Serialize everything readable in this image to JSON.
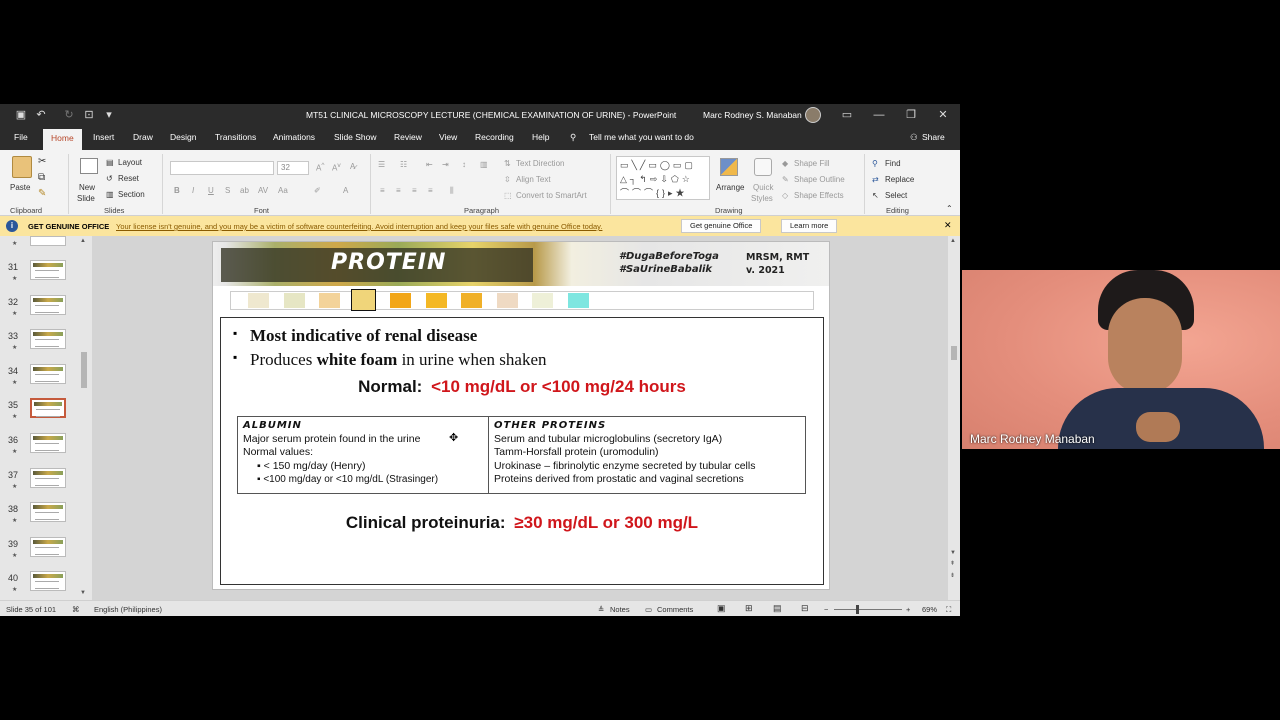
{
  "titlebar": {
    "title": "MT51 CLINICAL MICROSCOPY LECTURE (CHEMICAL EXAMINATION OF URINE)  -  PowerPoint",
    "user": "Marc Rodney S. Manaban"
  },
  "tabs": [
    "File",
    "Home",
    "Insert",
    "Draw",
    "Design",
    "Transitions",
    "Animations",
    "Slide Show",
    "Review",
    "View",
    "Recording",
    "Help"
  ],
  "tell_me": "Tell me what you want to do",
  "share": "Share",
  "ribbon": {
    "clipboard": {
      "paste": "Paste",
      "label": "Clipboard"
    },
    "slides": {
      "new_slide_1": "New",
      "new_slide_2": "Slide",
      "layout": "Layout",
      "reset": "Reset",
      "section": "Section",
      "label": "Slides"
    },
    "font": {
      "size": "32",
      "label": "Font"
    },
    "paragraph": {
      "text_direction": "Text Direction",
      "align_text": "Align Text",
      "convert": "Convert to SmartArt",
      "label": "Paragraph"
    },
    "drawing": {
      "arrange": "Arrange",
      "quick_styles_1": "Quick",
      "quick_styles_2": "Styles",
      "shape_fill": "Shape Fill",
      "shape_outline": "Shape Outline",
      "shape_effects": "Shape Effects",
      "label": "Drawing"
    },
    "editing": {
      "find": "Find",
      "replace": "Replace",
      "select": "Select",
      "label": "Editing"
    }
  },
  "warning": {
    "title": "GET GENUINE OFFICE",
    "message": "Your license isn't genuine, and you may be a victim of software counterfeiting. Avoid interruption and keep your files safe with genuine Office today.",
    "btn_genuine": "Get genuine Office",
    "btn_learn": "Learn more"
  },
  "thumbnails": [
    "31",
    "32",
    "33",
    "34",
    "35",
    "36",
    "37",
    "38",
    "39",
    "40"
  ],
  "selected_slide": "35",
  "slide": {
    "header": "PROTEIN",
    "tag1": "#DugaBeforeToga",
    "tag2": "#SaUrineBabalik",
    "author": "MRSM, RMT",
    "version": "v. 2021",
    "bullet1": "Most indicative of renal disease",
    "bullet2_pre": "Produces ",
    "bullet2_bold": "white foam",
    "bullet2_post": " in urine when shaken",
    "normal_label": "Normal:",
    "normal_value": "<10 mg/dL or <100 mg/24 hours",
    "albumin_title": "ALBUMIN",
    "albumin_line1": "Major serum protein found in the urine",
    "albumin_line2": "Normal values:",
    "albumin_b1": "< 150 mg/day (Henry)",
    "albumin_b2": "<100 mg/day or <10 mg/dL (Strasinger)",
    "other_title": "OTHER PROTEINS",
    "other_1": "Serum and tubular microglobulins (secretory IgA)",
    "other_2": "Tamm-Horsfall protein (uromodulin)",
    "other_3": "Urokinase – fibrinolytic enzyme secreted by tubular cells",
    "other_4": "Proteins derived from prostatic and vaginal secretions",
    "clinical_label": "Clinical proteinuria:",
    "clinical_value": "≥30 mg/dL or 300 mg/L"
  },
  "color_strip": [
    "#efe8cf",
    "#e6e6c4",
    "#f3d39a",
    "#f0d57a",
    "#f2a618",
    "#f4b825",
    "#f0b028",
    "#efdac3",
    "#eef0d8",
    "#7ee6e0"
  ],
  "status": {
    "slide_count": "Slide 35 of 101",
    "language": "English (Philippines)",
    "notes": "Notes",
    "comments": "Comments",
    "zoom": "69%"
  },
  "webcam": {
    "name": "Marc Rodney Manaban"
  }
}
